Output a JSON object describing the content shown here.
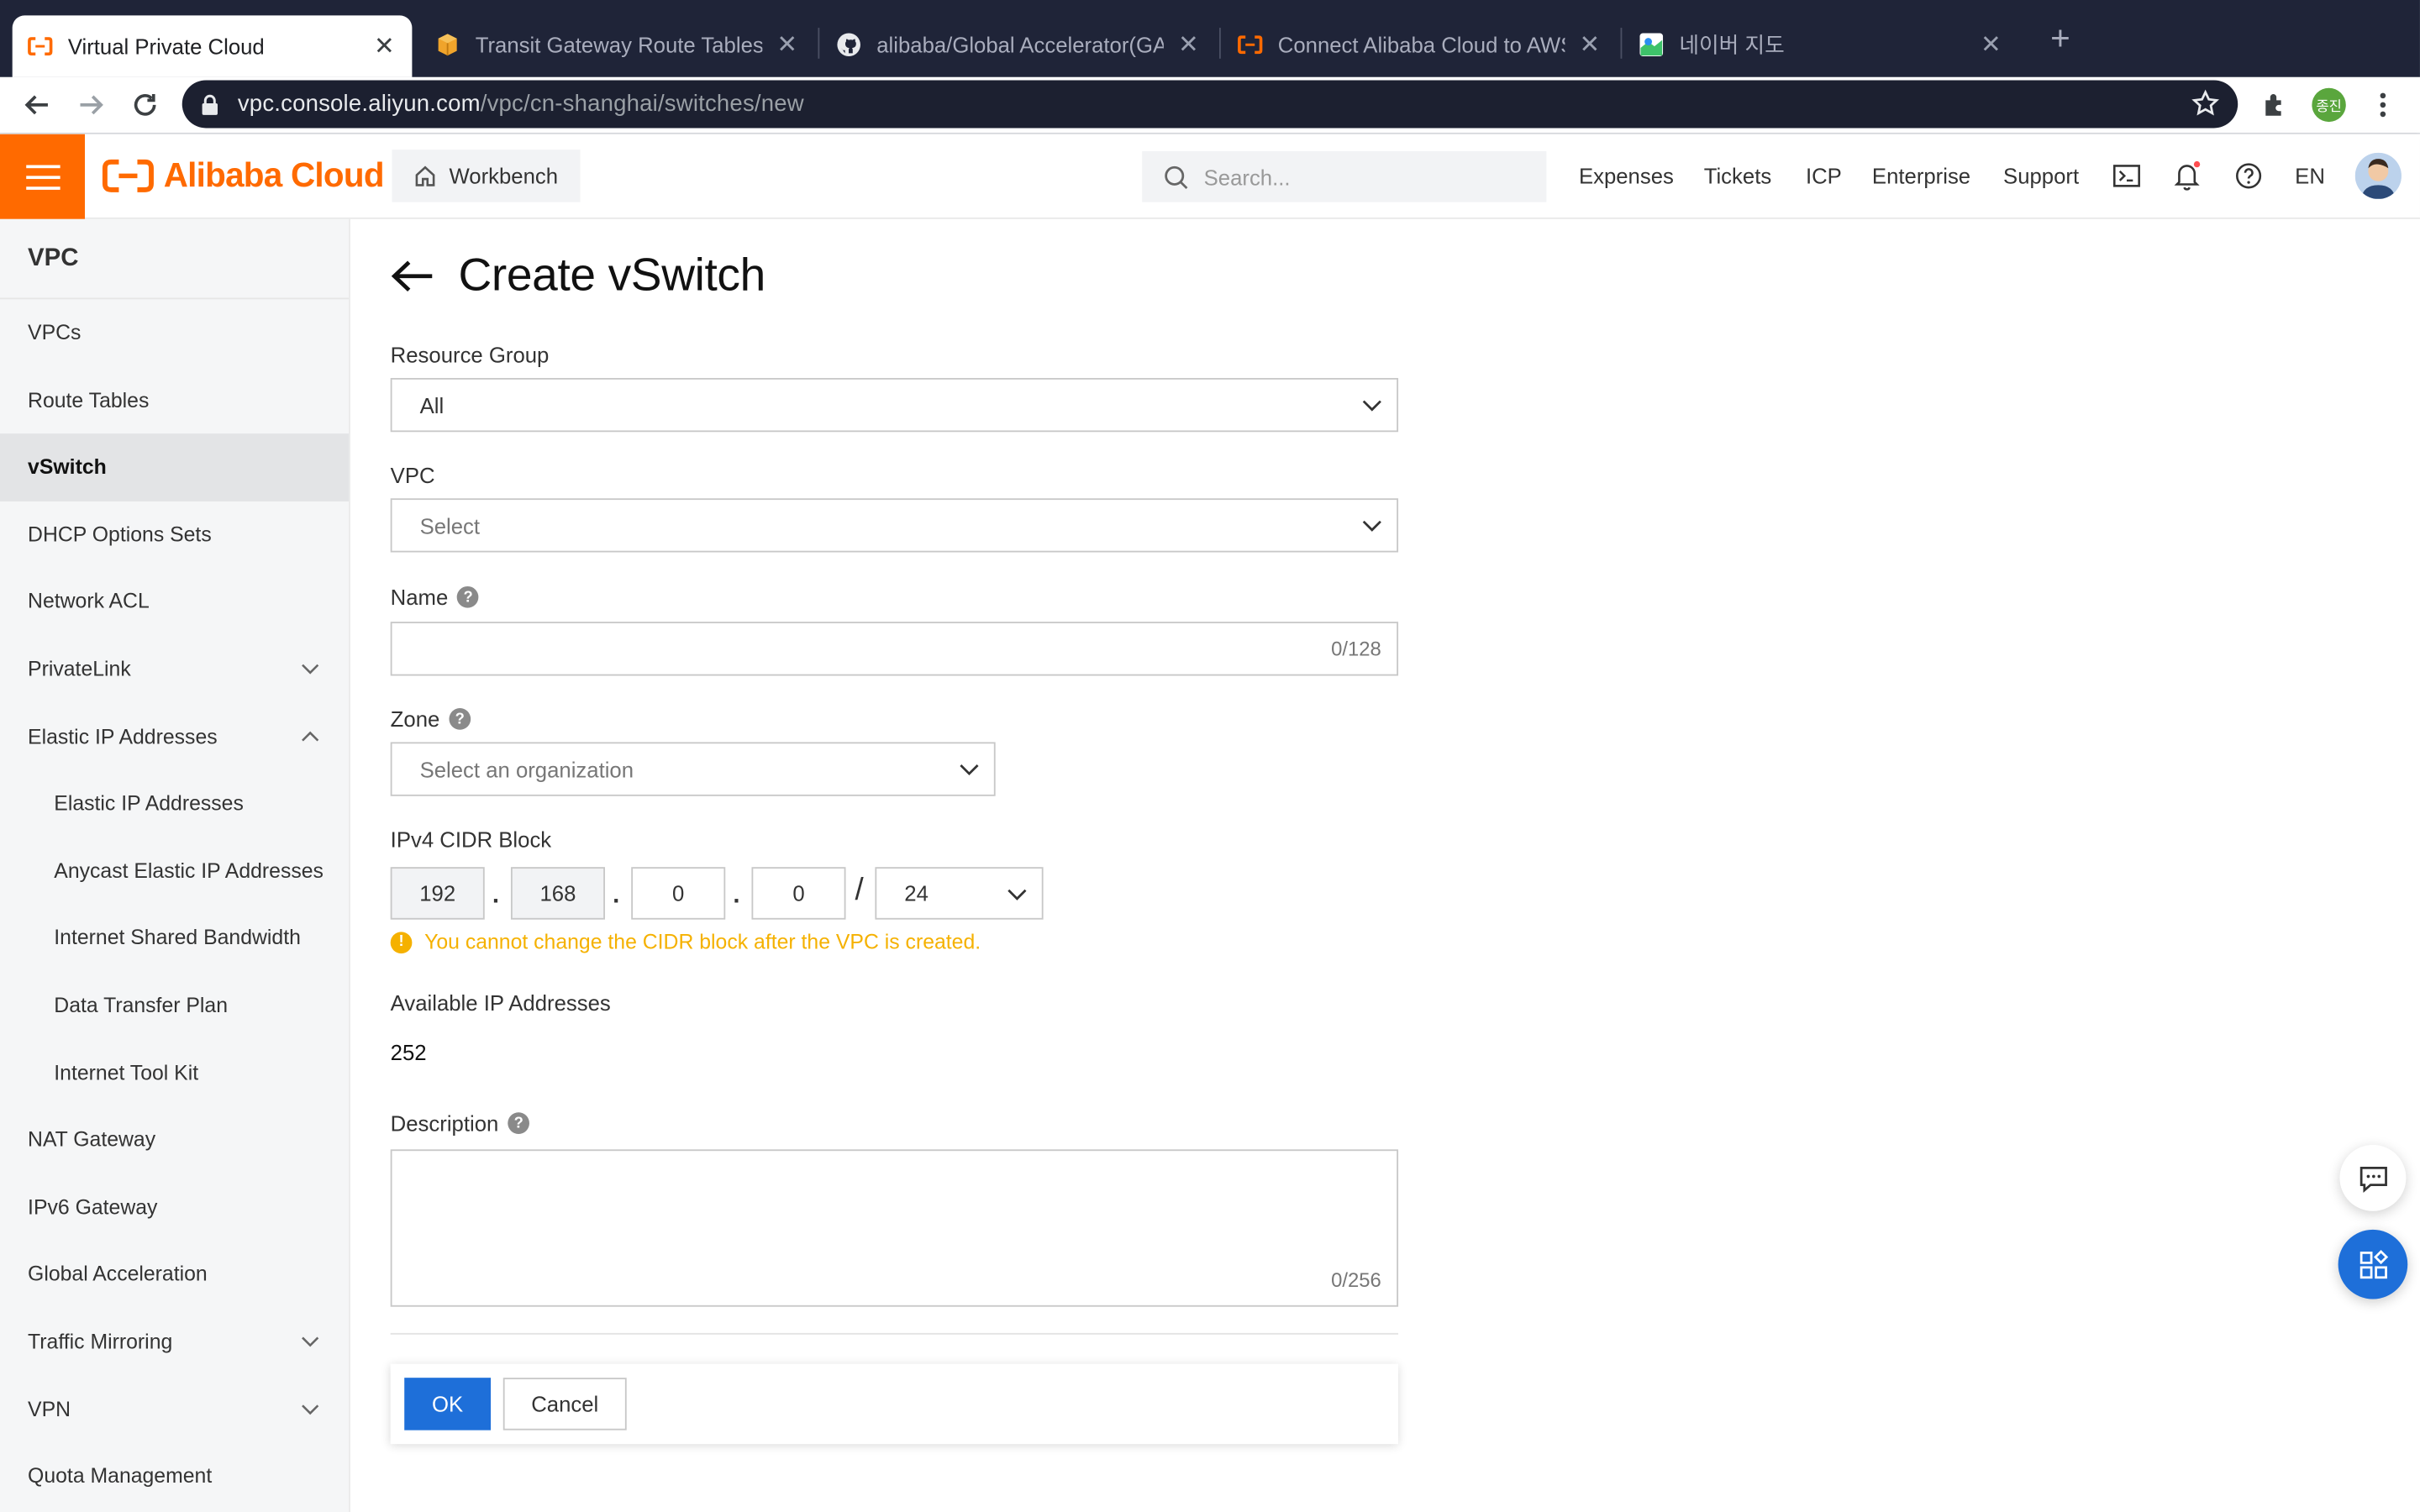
{
  "browser": {
    "tabs": [
      {
        "title": "Virtual Private Cloud",
        "active": true,
        "favicon": "alibaba-icon"
      },
      {
        "title": "Transit Gateway Route Tables |",
        "active": false,
        "favicon": "box-icon"
      },
      {
        "title": "alibaba/Global Accelerator(GA",
        "active": false,
        "favicon": "github-icon"
      },
      {
        "title": "Connect Alibaba Cloud to AWS",
        "active": false,
        "favicon": "alibaba-icon"
      },
      {
        "title": "네이버 지도",
        "active": false,
        "favicon": "naver-map-icon"
      }
    ],
    "url_host": "vpc.console.aliyun.com",
    "url_path": "/vpc/cn-shanghai/switches/new",
    "profile_badge": "종진"
  },
  "header": {
    "logo_text": "Alibaba Cloud",
    "workbench": "Workbench",
    "search_placeholder": "Search...",
    "links": [
      "Expenses",
      "Tickets",
      "ICP",
      "Enterprise",
      "Support"
    ],
    "language": "EN",
    "accent": "#ff6a00"
  },
  "sidebar": {
    "title": "VPC",
    "items": [
      {
        "label": "VPCs"
      },
      {
        "label": "Route Tables"
      },
      {
        "label": "vSwitch",
        "active": true
      },
      {
        "label": "DHCP Options Sets"
      },
      {
        "label": "Network ACL"
      },
      {
        "label": "PrivateLink",
        "chevron": "down"
      },
      {
        "label": "Elastic IP Addresses",
        "chevron": "up"
      },
      {
        "label": "Elastic IP Addresses",
        "sub": true
      },
      {
        "label": "Anycast Elastic IP Addresses",
        "sub": true
      },
      {
        "label": "Internet Shared Bandwidth",
        "sub": true
      },
      {
        "label": "Data Transfer Plan",
        "sub": true
      },
      {
        "label": "Internet Tool Kit",
        "sub": true
      },
      {
        "label": "NAT Gateway"
      },
      {
        "label": "IPv6 Gateway"
      },
      {
        "label": "Global Acceleration"
      },
      {
        "label": "Traffic Mirroring",
        "chevron": "down"
      },
      {
        "label": "VPN",
        "chevron": "down"
      },
      {
        "label": "Quota Management"
      }
    ]
  },
  "form": {
    "title": "Create vSwitch",
    "resource_group": {
      "label": "Resource Group",
      "value": "All"
    },
    "vpc": {
      "label": "VPC",
      "placeholder": "Select"
    },
    "name": {
      "label": "Name",
      "counter": "0/128"
    },
    "zone": {
      "label": "Zone",
      "placeholder": "Select an organization"
    },
    "cidr": {
      "label": "IPv4 CIDR Block",
      "octets": [
        "192",
        "168",
        "0",
        "0"
      ],
      "separator": "/",
      "mask": "24",
      "warning": "You cannot change the CIDR block after the VPC is created."
    },
    "available": {
      "label": "Available IP Addresses",
      "value": "252"
    },
    "description": {
      "label": "Description",
      "counter": "0/256"
    },
    "ok": "OK",
    "cancel": "Cancel",
    "primary_color": "#1e6fd9",
    "warning_color": "#f5b100"
  }
}
